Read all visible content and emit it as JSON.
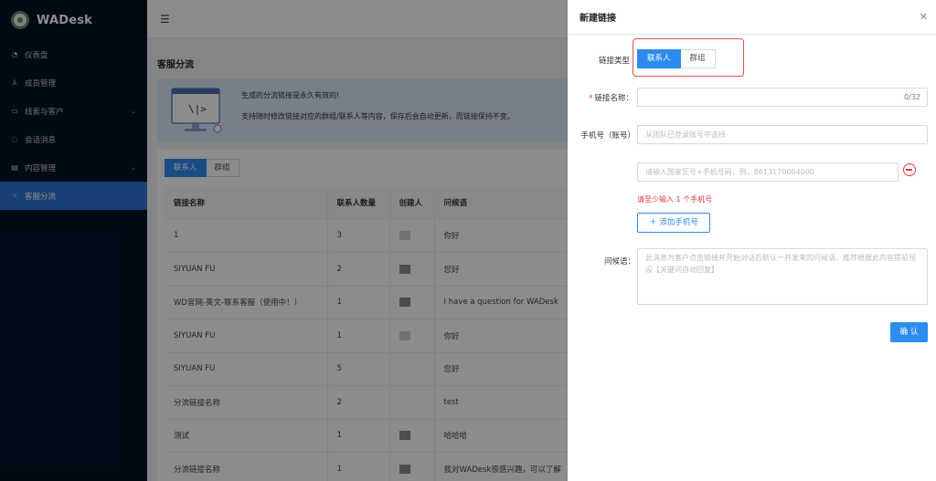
{
  "app": {
    "name": "WADesk"
  },
  "sidebar": {
    "items": [
      {
        "label": "仪表盘",
        "icon": "dashboard-icon",
        "glyph": "◔"
      },
      {
        "label": "成员管理",
        "icon": "members-icon",
        "glyph": "⅄"
      },
      {
        "label": "线索与客户",
        "icon": "leads-icon",
        "glyph": "▭",
        "has_arrow": true
      },
      {
        "label": "会话消息",
        "icon": "chat-icon",
        "glyph": "◌"
      },
      {
        "label": "内容管理",
        "icon": "content-icon",
        "glyph": "▤",
        "has_arrow": true
      },
      {
        "label": "客服分流",
        "icon": "routing-icon",
        "glyph": "⑂",
        "active": true
      }
    ]
  },
  "main": {
    "title": "客服分流",
    "banner": {
      "line1": "生成的分流链接是永久有效的!",
      "line2": "支持随时修改链接对应的群组/联系人等内容，保存后会自动更新，而链接保持不变。"
    },
    "tabs": [
      "联系人",
      "群组"
    ],
    "table": {
      "headers": [
        "链接名称",
        "联系人数量",
        "创建人",
        "问候语"
      ],
      "rows": [
        {
          "name": "1",
          "count": "3",
          "avatar": "light",
          "greeting": "你好"
        },
        {
          "name": "SIYUAN FU",
          "count": "2",
          "avatar": "dark",
          "greeting": "您好"
        },
        {
          "name": "WD官网-英文-联系客服（使用中！）",
          "count": "1",
          "avatar": "dark",
          "greeting": "I have a question for WADesk"
        },
        {
          "name": "SIYUAN FU",
          "count": "1",
          "avatar": "light",
          "greeting": "你好"
        },
        {
          "name": "SIYUAN FU",
          "count": "5",
          "avatar": "none",
          "greeting": "您好"
        },
        {
          "name": "分流链接名称",
          "count": "2",
          "avatar": "none",
          "greeting": "test"
        },
        {
          "name": "测试",
          "count": "1",
          "avatar": "dark",
          "greeting": "哈哈哈"
        },
        {
          "name": "分流链接名称",
          "count": "1",
          "avatar": "dark",
          "greeting": "我对WADesk很感兴趣，可以了解"
        }
      ]
    }
  },
  "drawer": {
    "title": "新建链接",
    "link_type_label": "链接类型",
    "link_type_options": [
      "联系人",
      "群组"
    ],
    "link_type_selected": "联系人",
    "link_name_label": "链接名称：",
    "link_name_counter": "0/32",
    "phone_account_label": "手机号（账号）",
    "phone_account_placeholder": "从团队已登录账号中选择",
    "phone_input_placeholder": "请输入国家区号+手机号码，例，8613170004000",
    "error_text": "请至少输入 1 个手机号",
    "add_phone_label": "添加手机号",
    "greeting_label": "问候语：",
    "greeting_placeholder": "此消息为客户点击链接并开始对话后默认一并发来的问候语，推荐根据此内容提前预设【关键词自动回复】",
    "confirm_label": "确 认"
  },
  "colors": {
    "primary": "#2d8cf0",
    "sidebar_bg": "#001529",
    "error": "#e4393c",
    "highlight_box": "#d9534f"
  }
}
